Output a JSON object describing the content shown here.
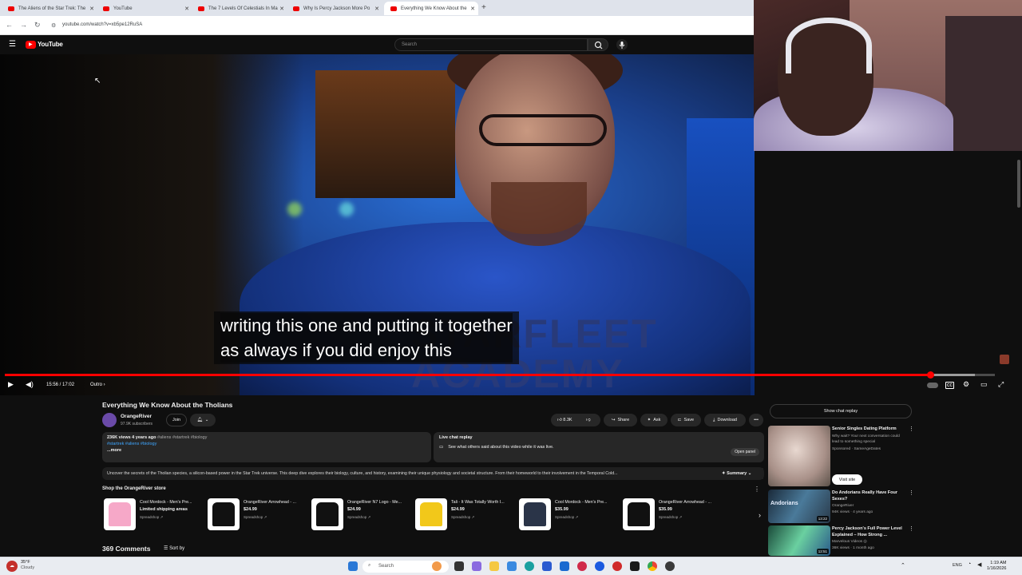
{
  "browser": {
    "tabs": [
      {
        "title": "The Aliens of the Star Trek: The"
      },
      {
        "title": "YouTube"
      },
      {
        "title": "The 7 Levels Of Celestials In Ma"
      },
      {
        "title": "Why Is Percy Jackson More Po"
      },
      {
        "title": "Everything We Know About the"
      }
    ],
    "new_tab": "+",
    "url": "youtube.com/watch?v=xb5pe12RuSA"
  },
  "youtube": {
    "logo_text": "YouTube",
    "search_placeholder": "Search"
  },
  "player": {
    "caption_line1": "writing this one and putting it together",
    "caption_line2": "as always if you did enjoy this",
    "shirt_text": "STARFLEET ACADEMY",
    "time": "15:56 / 17:02",
    "chapter": "Outro ›",
    "progress": 0.935,
    "buffered": 0.98
  },
  "video": {
    "title": "Everything We Know About the Tholians",
    "channel": "OrangeRiver",
    "subscribers": "97.9K subscribers",
    "join_label": "Join",
    "likes": "8.3K",
    "share_label": "Share",
    "ask_label": "Ask",
    "save_label": "Save",
    "download_label": "Download",
    "description": {
      "stats": "236K views  4 years ago",
      "inline_tags": "#aliens #startrek #biology",
      "tags": "#startrek #aliens #biology",
      "more": "...more"
    },
    "live_chat": {
      "title": "Live chat replay",
      "text": "See what others said about this video while it was live.",
      "button": "Open panel"
    },
    "summary": {
      "text": "Uncover the secrets of the Tholian species, a silicon-based power in the Star Trek universe. This deep dive explores their biology, culture, and history, examining their unique physiology and societal structure. From their homeworld to their involvement in the Temporal Cold...",
      "button": "✦ Summary"
    }
  },
  "store": {
    "title": "Shop the OrangeRiver store",
    "products": [
      {
        "name": "Cool Mordock - Men's Pre...",
        "price": "Limited shipping areas",
        "seller": "Spreadshop ↗",
        "color": "#f6a8c8"
      },
      {
        "name": "OrangeRiver Arrowhead - ...",
        "price": "$24.99",
        "seller": "Spreadshop ↗",
        "color": "#111111"
      },
      {
        "name": "OrangeRiver N7 Logo - Me...",
        "price": "$24.99",
        "seller": "Spreadshop ↗",
        "color": "#111111"
      },
      {
        "name": "Tali - It Was Totally Worth I...",
        "price": "$24.99",
        "seller": "Spreadshop ↗",
        "color": "#f2c81a"
      },
      {
        "name": "Cool Mordock - Men's Pre...",
        "price": "$35.99",
        "seller": "Spreadshop ↗",
        "color": "#2a3448"
      },
      {
        "name": "OrangeRiver Arrowhead - ...",
        "price": "$35.99",
        "seller": "Spreadshop ↗",
        "color": "#111111"
      }
    ]
  },
  "comments": {
    "count": "369 Comments",
    "sort_label": "Sort by"
  },
  "sidebar": {
    "show_chat": "Show chat replay",
    "ad": {
      "title": "Senior Singles Dating Platform",
      "text": "Why wait? Your next conversation could lead to something special",
      "sponsor": "Sponsored · SameAgeDates",
      "button": "Visit site"
    },
    "recs": [
      {
        "title": "Do Andorians Really Have Four Sexes?",
        "channel": "OrangeRiver",
        "meta": "94K views · 4 years ago",
        "duration": "13:22",
        "thumb_text": "Andorians"
      },
      {
        "title": "Percy Jackson's Full Power Level Explained – How Strong ...",
        "channel": "Marvelous Videos ◎",
        "meta": "36K views · 1 month ago",
        "duration": "12:51",
        "thumb_text": ""
      }
    ]
  },
  "taskbar": {
    "weather_temp": "35°F",
    "weather_text": "Cloudy",
    "search": "Search",
    "lang": "ENG",
    "time": "1:19 AM",
    "date": "1/16/2026"
  }
}
